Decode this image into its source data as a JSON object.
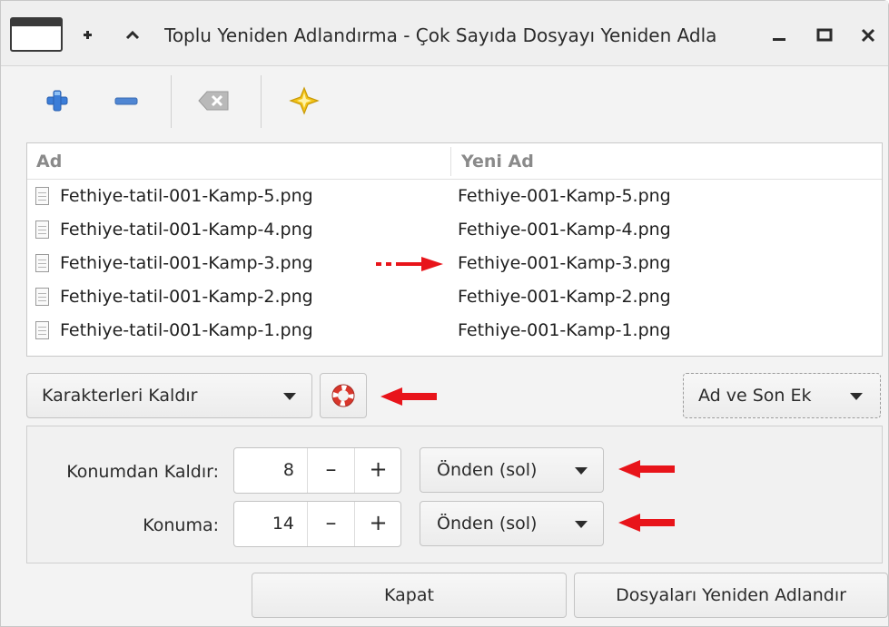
{
  "window": {
    "title": "Toplu Yeniden Adlandırma - Çok Sayıda Dosyayı Yeniden Adla",
    "controls": {
      "add": "+",
      "up": "^",
      "minimize": "_",
      "restore": "□",
      "close": "×"
    }
  },
  "toolbar": {
    "items": [
      {
        "name": "add-files",
        "icon": "plus-icon"
      },
      {
        "name": "remove-files",
        "icon": "minus-icon"
      },
      {
        "name": "clear-list",
        "icon": "backspace-clear-icon"
      },
      {
        "name": "about",
        "icon": "star-icon"
      }
    ]
  },
  "filelist": {
    "col_name": "Ad",
    "col_newname": "Yeni Ad",
    "rows": [
      {
        "name": "Fethiye-tatil-001-Kamp-5.png",
        "new_name": "Fethiye-001-Kamp-5.png"
      },
      {
        "name": "Fethiye-tatil-001-Kamp-4.png",
        "new_name": "Fethiye-001-Kamp-4.png"
      },
      {
        "name": "Fethiye-tatil-001-Kamp-3.png",
        "new_name": "Fethiye-001-Kamp-3.png"
      },
      {
        "name": "Fethiye-tatil-001-Kamp-2.png",
        "new_name": "Fethiye-001-Kamp-2.png"
      },
      {
        "name": "Fethiye-tatil-001-Kamp-1.png",
        "new_name": "Fethiye-001-Kamp-1.png"
      }
    ]
  },
  "controls": {
    "mode_select": "Karakterleri Kaldır",
    "help_icon": "lifebuoy-icon",
    "scope_select": "Ad ve Son Ek"
  },
  "options": {
    "remove_from_label": "Konumdan Kaldır:",
    "remove_from_value": "8",
    "remove_from_side": "Önden (sol)",
    "to_label": "Konuma:",
    "to_value": "14",
    "to_side": "Önden (sol)",
    "minus": "–",
    "plus": "+"
  },
  "actions": {
    "close": "Kapat",
    "rename": "Dosyaları Yeniden Adlandır"
  },
  "colors": {
    "annotation_arrow": "#e8141a",
    "header_text": "#8a8a8a",
    "plus_icon": "#3b7dd8",
    "star_icon": "#f3c316"
  }
}
